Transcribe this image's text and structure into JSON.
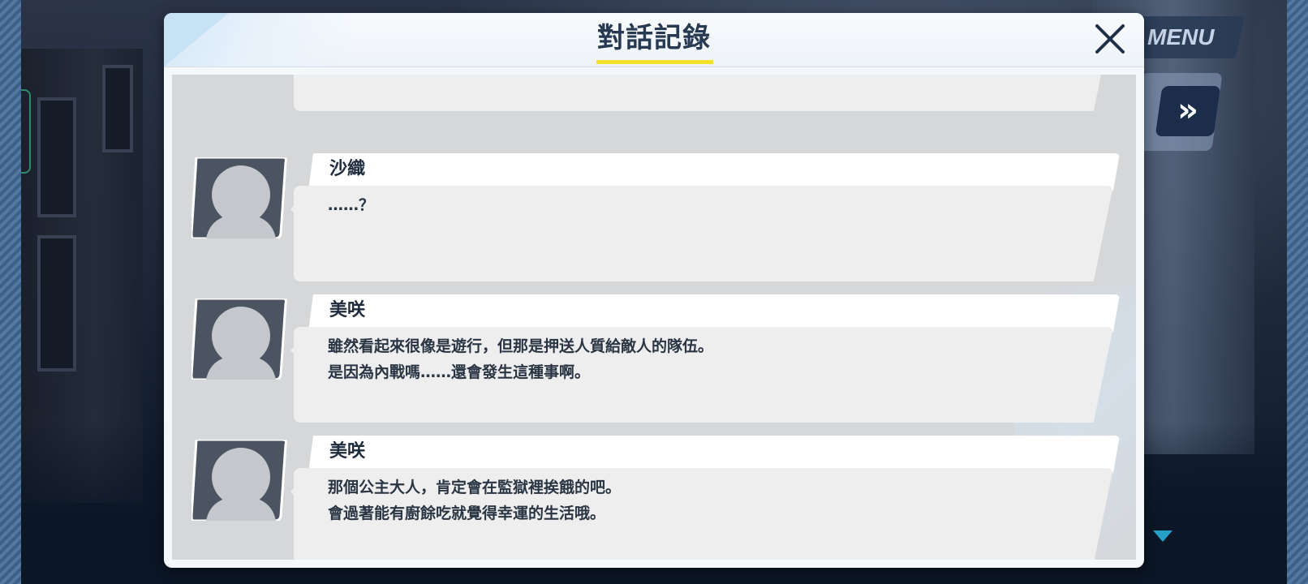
{
  "header": {
    "title": "對話記錄",
    "menu_label": "MENU",
    "fast_forward_label": "»"
  },
  "log": [
    {
      "speaker": "",
      "lines": [
        "",
        ""
      ]
    },
    {
      "speaker": "沙織",
      "lines": [
        "……？",
        ""
      ]
    },
    {
      "speaker": "美咲",
      "lines": [
        "雖然看起來很像是遊行，但那是押送人質給敵人的隊伍。",
        "是因為內戰嗎……還會發生這種事啊。"
      ]
    },
    {
      "speaker": "美咲",
      "lines": [
        "那個公主大人，肯定會在監獄裡挨餓的吧。",
        "會過著能有廚餘吃就覺得幸運的生活哦。"
      ]
    }
  ],
  "colors": {
    "title_text": "#273a52",
    "title_underline": "#f2e02b",
    "fast_forward_bg": "#1b2d4a",
    "scroll_arrow": "#27a0c8"
  },
  "icons": {
    "close": "close-icon",
    "fast_forward": "fast-forward-icon",
    "avatar": "avatar-placeholder-icon",
    "scroll": "scroll-down-icon"
  }
}
